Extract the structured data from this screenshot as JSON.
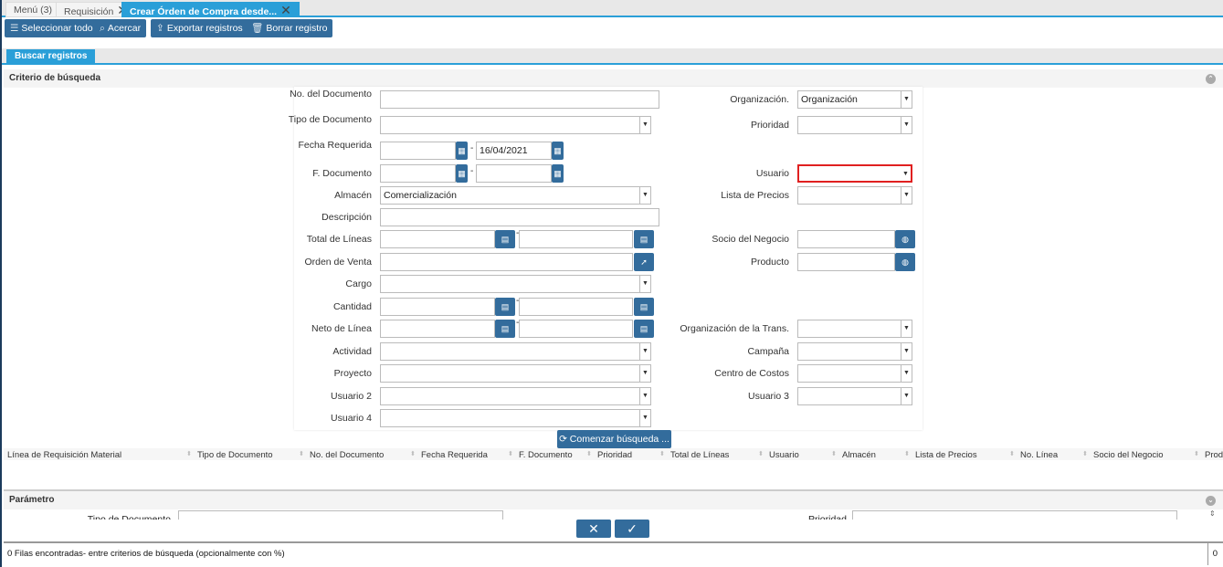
{
  "tabs": [
    {
      "label": "Menú (3)"
    },
    {
      "label": "Requisición"
    },
    {
      "label": "Crear Órden de Compra desde..."
    }
  ],
  "toolbar": {
    "select_all": "Seleccionar todo",
    "zoom": "Acercar",
    "export": "Exportar registros",
    "delete": "Borrar registro"
  },
  "subtab": "Buscar registros",
  "criteria_title": "Criterio de búsqueda",
  "left_fields": [
    {
      "label": "No. del Documento",
      "type": "text",
      "value": ""
    },
    {
      "label": "Tipo de Documento",
      "type": "select",
      "value": ""
    },
    {
      "label": "Fecha Requerida",
      "type": "date-range",
      "from": "",
      "to": "16/04/2021"
    },
    {
      "label": "F. Documento",
      "type": "date-range",
      "from": "",
      "to": ""
    },
    {
      "label": "Almacén",
      "type": "select",
      "value": "Comercialización"
    },
    {
      "label": "Descripción",
      "type": "text",
      "value": ""
    },
    {
      "label": "Total de Líneas",
      "type": "number-range",
      "from": "",
      "to": ""
    },
    {
      "label": "Orden de Venta",
      "type": "search",
      "value": ""
    },
    {
      "label": "Cargo",
      "type": "select",
      "value": ""
    },
    {
      "label": "Cantidad",
      "type": "number-range",
      "from": "",
      "to": ""
    },
    {
      "label": "Neto de Línea",
      "type": "number-range",
      "from": "",
      "to": ""
    },
    {
      "label": "Actividad",
      "type": "select",
      "value": ""
    },
    {
      "label": "Proyecto",
      "type": "select",
      "value": ""
    },
    {
      "label": "Usuario 2",
      "type": "select",
      "value": ""
    },
    {
      "label": "Usuario 4",
      "type": "select",
      "value": ""
    }
  ],
  "right_fields": [
    {
      "label": "Organización.",
      "type": "select",
      "value": "Organización"
    },
    {
      "label": "Prioridad",
      "type": "select",
      "value": ""
    },
    {
      "label": "Usuario",
      "type": "select",
      "value": "",
      "error": true
    },
    {
      "label": "Lista de Precios",
      "type": "select",
      "value": ""
    },
    {
      "label": "Socio del Negocio",
      "type": "search",
      "value": ""
    },
    {
      "label": "Producto",
      "type": "search",
      "value": ""
    },
    {
      "label": "Organización de la Trans.",
      "type": "select",
      "value": ""
    },
    {
      "label": "Campaña",
      "type": "select",
      "value": ""
    },
    {
      "label": "Centro de Costos",
      "type": "select",
      "value": ""
    },
    {
      "label": "Usuario 3",
      "type": "select",
      "value": ""
    }
  ],
  "search_button": "Comenzar búsqueda ...",
  "grid_columns": [
    "Línea de Requisición Material",
    "Tipo de Documento",
    "No. del Documento",
    "Fecha Requerida",
    "F. Documento",
    "Prioridad",
    "Total de Líneas",
    "Usuario",
    "Almacén",
    "Lista de Precios",
    "No. Línea",
    "Socio del Negocio",
    "Prod"
  ],
  "parameter_title": "Parámetro",
  "parameter_labels": [
    "Tipo de Documento",
    "Prioridad"
  ],
  "status_text": "0 Filas encontradas- entre criterios de búsqueda (opcionalmente con %)",
  "status_count": "0",
  "colors": {
    "accent": "#2a9fd8",
    "button": "#336c9c",
    "error": "#e02020"
  }
}
